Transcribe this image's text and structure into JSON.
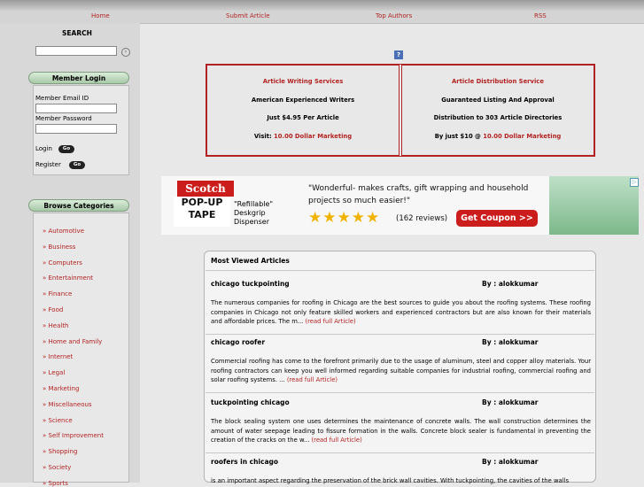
{
  "nav": [
    "Home",
    "Submit Article",
    "Top Authors",
    "RSS"
  ],
  "search": {
    "title": "SEARCH",
    "go": "›"
  },
  "login": {
    "title": "Member Login",
    "email_label": "Member Email ID",
    "password_label": "Member Password",
    "login_label": "Login",
    "register_label": "Register",
    "go": "Go"
  },
  "categories": {
    "title": "Browse Categories",
    "items": [
      "» Automotive",
      "» Business",
      "» Computers",
      "» Entertainment",
      "» Finance",
      "» Food",
      "» Health",
      "» Home and Family",
      "» Internet",
      "» Legal",
      "» Marketing",
      "» Miscellaneous",
      "» Science",
      "» Self Improvement",
      "» Shopping",
      "» Society",
      "» Sports"
    ]
  },
  "help_icon": "?",
  "services": {
    "left": {
      "title": "Article Writing Services",
      "line1": "American Experienced Writers",
      "line2": "Just $4.95 Per Article",
      "line3_prefix": "Visit: ",
      "line3_link": "10.00 Dollar Marketing"
    },
    "right": {
      "title": "Article Distribution Service",
      "line1": "Guaranteed Listing And Approval",
      "line2": "Distribution to 303 Article Directories",
      "line3_prefix": "By just $10 @ ",
      "line3_link": "10.00 Dollar Marketing"
    }
  },
  "ad": {
    "brand": "Scotch",
    "product": "POP-UP TAPE",
    "refill": "\"Refillable\" Deskgrip Dispenser",
    "quote_line1": "\"Wonderful- makes crafts, gift wrapping and household",
    "quote_line2": "projects so much easier!\"",
    "stars": "★★★★★",
    "reviews": "(162 reviews)",
    "cta": "Get Coupon >>",
    "close": "▷"
  },
  "articles": {
    "heading": "Most Viewed Articles",
    "read_more": "(read full Article)",
    "items": [
      {
        "title": "chicago tuckpointing",
        "by": "By : alokkumar",
        "text": "The numerous companies for roofing in Chicago are the best sources to guide you about the roofing systems. These roofing companies in Chicago not only feature skilled workers and experienced contractors but are also known for their materials and affordable prices. The m... "
      },
      {
        "title": "chicago roofer",
        "by": "By : alokkumar",
        "text": "Commercial roofing has come to the forefront primarily due to the usage of aluminum, steel and copper alloy materials. Your roofing contractors can keep you well informed regarding suitable companies for industrial roofing, commercial roofing and solar roofing systems. ... "
      },
      {
        "title": "tuckpointing chicago",
        "by": "By : alokkumar",
        "text": "The block sealing system one uses determines the maintenance of concrete walls. The wall construction determines the amount of water seepage leading to fissure formation in the walls. Concrete block sealer is fundamental in preventing the creation of the cracks on the w... "
      },
      {
        "title": "roofers in chicago",
        "by": "By : alokkumar",
        "text": "is an important aspect regarding the preservation of the brick wall cavities. With tuckpointing, the cavities of the walls"
      }
    ]
  }
}
